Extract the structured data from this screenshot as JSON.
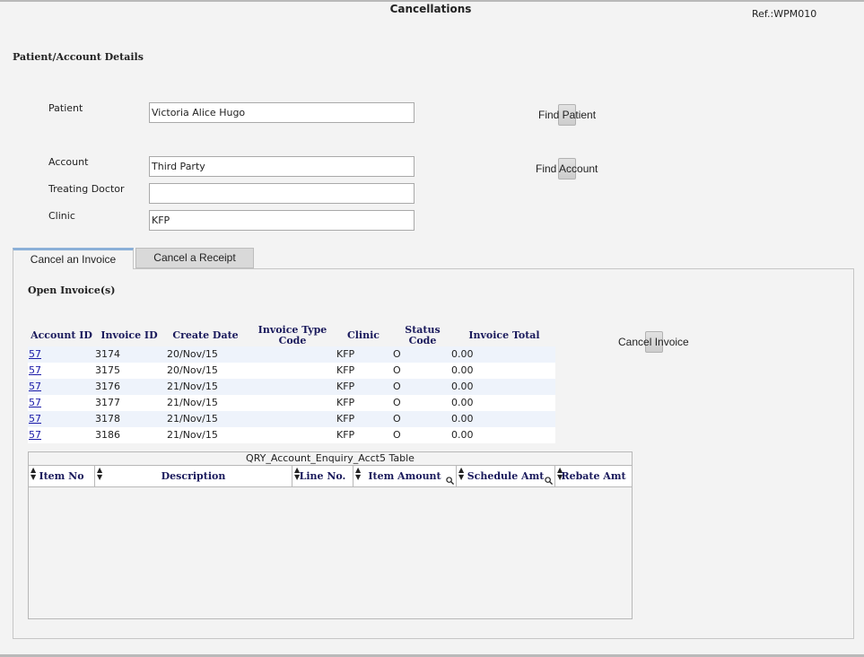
{
  "header": {
    "title": "Cancellations",
    "ref": "Ref.:WPM010"
  },
  "details": {
    "section_title": "Patient/Account Details",
    "patient_label": "Patient",
    "patient_value": "Victoria Alice Hugo",
    "account_label": "Account",
    "account_value": "Third Party",
    "doctor_label": "Treating Doctor",
    "doctor_value": "",
    "clinic_label": "Clinic",
    "clinic_value": "KFP",
    "find_patient_label": "Find Patient",
    "find_account_label": "Find Account"
  },
  "tabs": [
    {
      "label": "Cancel an Invoice",
      "active": true
    },
    {
      "label": "Cancel a Receipt",
      "active": false
    }
  ],
  "invoices": {
    "title": "Open Invoice(s)",
    "cancel_button_label": "Cancel Invoice",
    "headers": {
      "account_id": "Account ID",
      "invoice_id": "Invoice ID",
      "create_date": "Create Date",
      "invoice_type_line1": "Invoice Type",
      "invoice_type_line2": "Code",
      "clinic": "Clinic",
      "status_line1": "Status",
      "status_line2": "Code",
      "total": "Invoice Total"
    },
    "rows": [
      {
        "account_id": "57",
        "invoice_id": "3174",
        "create_date": "20/Nov/15",
        "type_code": "",
        "clinic": "KFP",
        "status": "O",
        "total": "0.00"
      },
      {
        "account_id": "57",
        "invoice_id": "3175",
        "create_date": "20/Nov/15",
        "type_code": "",
        "clinic": "KFP",
        "status": "O",
        "total": "0.00"
      },
      {
        "account_id": "57",
        "invoice_id": "3176",
        "create_date": "21/Nov/15",
        "type_code": "",
        "clinic": "KFP",
        "status": "O",
        "total": "0.00"
      },
      {
        "account_id": "57",
        "invoice_id": "3177",
        "create_date": "21/Nov/15",
        "type_code": "",
        "clinic": "KFP",
        "status": "O",
        "total": "0.00"
      },
      {
        "account_id": "57",
        "invoice_id": "3178",
        "create_date": "21/Nov/15",
        "type_code": "",
        "clinic": "KFP",
        "status": "O",
        "total": "0.00"
      },
      {
        "account_id": "57",
        "invoice_id": "3186",
        "create_date": "21/Nov/15",
        "type_code": "",
        "clinic": "KFP",
        "status": "O",
        "total": "0.00"
      }
    ]
  },
  "query_table": {
    "caption": "QRY_Account_Enquiry_Acct5 Table",
    "columns": [
      "Item No",
      "Description",
      "Line No.",
      "Item Amount",
      "Schedule Amt",
      "Rebate Amt"
    ]
  },
  "colors": {
    "header_text": "#1a1a5c",
    "link": "#1a1aa8",
    "tab_accent": "#8bb0d8",
    "row_alt": "#eef3fb"
  }
}
